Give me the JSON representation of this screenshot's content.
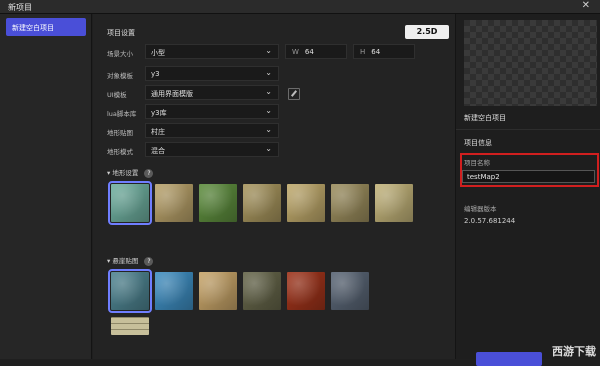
{
  "window": {
    "title": "新项目",
    "close_glyph": "✕"
  },
  "sidebar": {
    "items": [
      {
        "label": "新建空白项目"
      }
    ]
  },
  "settings": {
    "title": "项目设置",
    "mode_badge": "2.5D",
    "fields": {
      "scene_size": {
        "label": "场景大小",
        "value": "小型"
      },
      "width": {
        "key": "W",
        "value": "64"
      },
      "height": {
        "key": "H",
        "value": "64"
      },
      "object_template": {
        "label": "对象模板",
        "value": "y3"
      },
      "ui_template": {
        "label": "UI模板",
        "value": "通用界面模版"
      },
      "lua_lib": {
        "label": "lua脚本库",
        "value": "y3库"
      },
      "terrain_texture": {
        "label": "地形贴图",
        "value": "村庄"
      },
      "terrain_mode": {
        "label": "地形模式",
        "value": "混合"
      }
    }
  },
  "terrain_section": {
    "title": "地形设置",
    "help": "?",
    "tiles": [
      {
        "name": "tile-teal-rock",
        "color": "#6fb0a0",
        "selected": true
      },
      {
        "name": "tile-sand-grass",
        "color": "#b9a26a",
        "selected": false
      },
      {
        "name": "tile-grass",
        "color": "#5e8e3e",
        "selected": false
      },
      {
        "name": "tile-sand-stone",
        "color": "#a8965e",
        "selected": false
      },
      {
        "name": "tile-sand-pebbles",
        "color": "#c0aa6c",
        "selected": false
      },
      {
        "name": "tile-cobble",
        "color": "#9c8e5e",
        "selected": false
      },
      {
        "name": "tile-pale-sand",
        "color": "#c3b47a",
        "selected": false
      }
    ]
  },
  "cliff_section": {
    "title": "悬崖贴图",
    "help": "?",
    "tiles": [
      {
        "name": "cliff-teal-rock",
        "color": "#4f8592",
        "selected": true
      },
      {
        "name": "cliff-ice",
        "color": "#3f8fc3",
        "selected": false
      },
      {
        "name": "cliff-sand",
        "color": "#c9a66a",
        "selected": false
      },
      {
        "name": "cliff-mossy",
        "color": "#66664a",
        "selected": false
      },
      {
        "name": "cliff-lava",
        "color": "#a0341b",
        "selected": false
      },
      {
        "name": "cliff-slate",
        "color": "#5a6676",
        "selected": false
      },
      {
        "name": "cliff-brick",
        "color": "#c7bf9a",
        "selected": false
      }
    ]
  },
  "right_panel": {
    "preview_name": "新建空白项目",
    "info_title": "项目信息",
    "project_name_label": "项目名称",
    "project_name_value": "testMap2",
    "editor_version_label": "编辑器版本",
    "editor_version_value": "2.0.57.681244"
  },
  "watermark": "西游下载"
}
